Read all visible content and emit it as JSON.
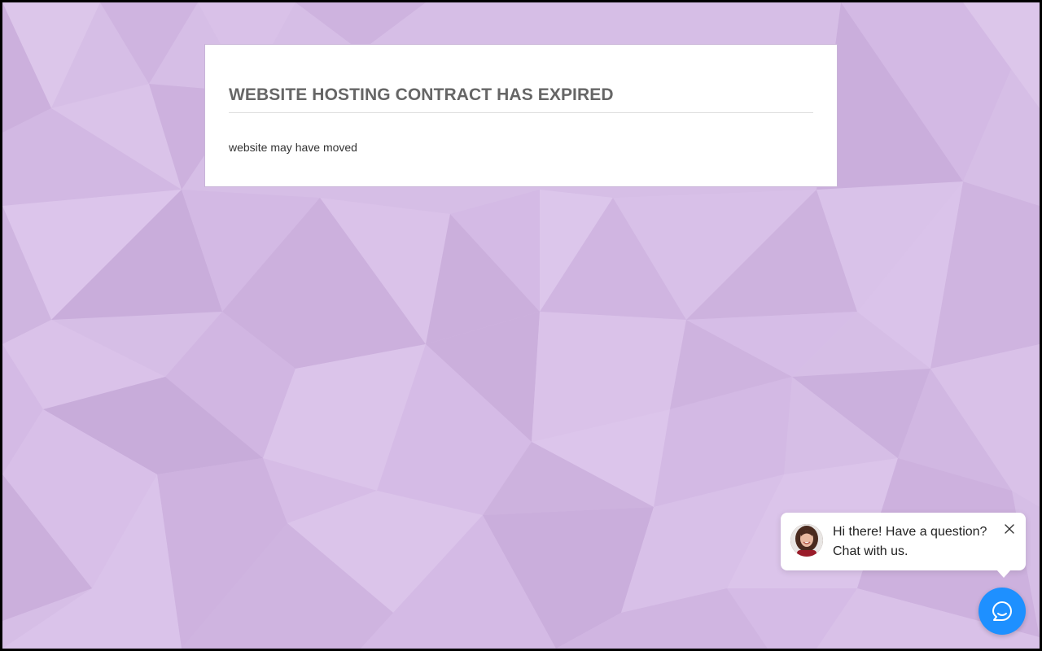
{
  "card": {
    "title": "WEBSITE HOSTING CONTRACT HAS EXPIRED",
    "message": "website may have moved"
  },
  "chat_widget": {
    "greeting_line1": "Hi there! Have a question?",
    "greeting_line2": "Chat with us.",
    "accent_color": "#1e90ff",
    "icons": {
      "close": "close-icon",
      "launcher": "chat-icon",
      "avatar": "agent-avatar"
    }
  },
  "theme": {
    "background": "#d6bee6",
    "card_background": "#ffffff",
    "title_color": "#666666"
  }
}
